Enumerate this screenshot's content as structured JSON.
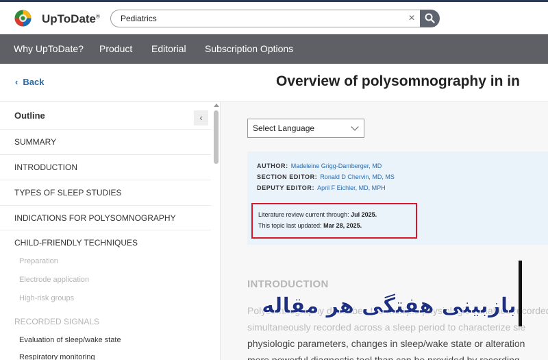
{
  "header": {
    "logo_text": "UpToDate",
    "logo_reg": "®",
    "search_value": "Pediatrics",
    "clear_glyph": "×"
  },
  "nav": {
    "items": [
      {
        "label": "Why UpToDate?"
      },
      {
        "label": "Product"
      },
      {
        "label": "Editorial"
      },
      {
        "label": "Subscription Options"
      }
    ]
  },
  "topic": {
    "back_label": "Back",
    "title": "Overview of polysomnography in in"
  },
  "sidebar": {
    "outline_label": "Outline",
    "collapse_glyph": "‹",
    "items": [
      {
        "label": "SUMMARY"
      },
      {
        "label": "INTRODUCTION"
      },
      {
        "label": "TYPES OF SLEEP STUDIES"
      },
      {
        "label": "INDICATIONS FOR POLYSOMNOGRAPHY"
      },
      {
        "label": "CHILD-FRIENDLY TECHNIQUES"
      },
      {
        "label": "Preparation"
      },
      {
        "label": "Electrode application"
      },
      {
        "label": "High-risk groups"
      },
      {
        "label": "RECORDED SIGNALS"
      },
      {
        "label": "Evaluation of sleep/wake state"
      },
      {
        "label": "Respiratory monitoring"
      }
    ]
  },
  "content": {
    "language_select": "Select Language",
    "author_label": "AUTHOR:",
    "author_value": "Madeleine Grigg-Damberger, MD",
    "section_editor_label": "SECTION EDITOR:",
    "section_editor_value": "Ronald D Chervin, MD, MS",
    "deputy_editor_label": "DEPUTY EDITOR:",
    "deputy_editor_value": "April F Eichler, MD, MPH",
    "review_prefix": "Literature review current through:",
    "review_date": "Jul 2025.",
    "updated_prefix": "This topic last updated:",
    "updated_date": "Mar 28, 2025.",
    "intro_heading": "INTRODUCTION",
    "para_lines": [
      "Polysomnography describes the multiple physiologic variables recorded during",
      "simultaneously recorded across a sleep period to characterize sle",
      "physiologic parameters, changes in sleep/wake state or alteration",
      "more powerful diagnostic tool than can be provided by recording"
    ]
  },
  "overlay": {
    "text": "بازبینی هفتگی هر مقاله"
  }
}
